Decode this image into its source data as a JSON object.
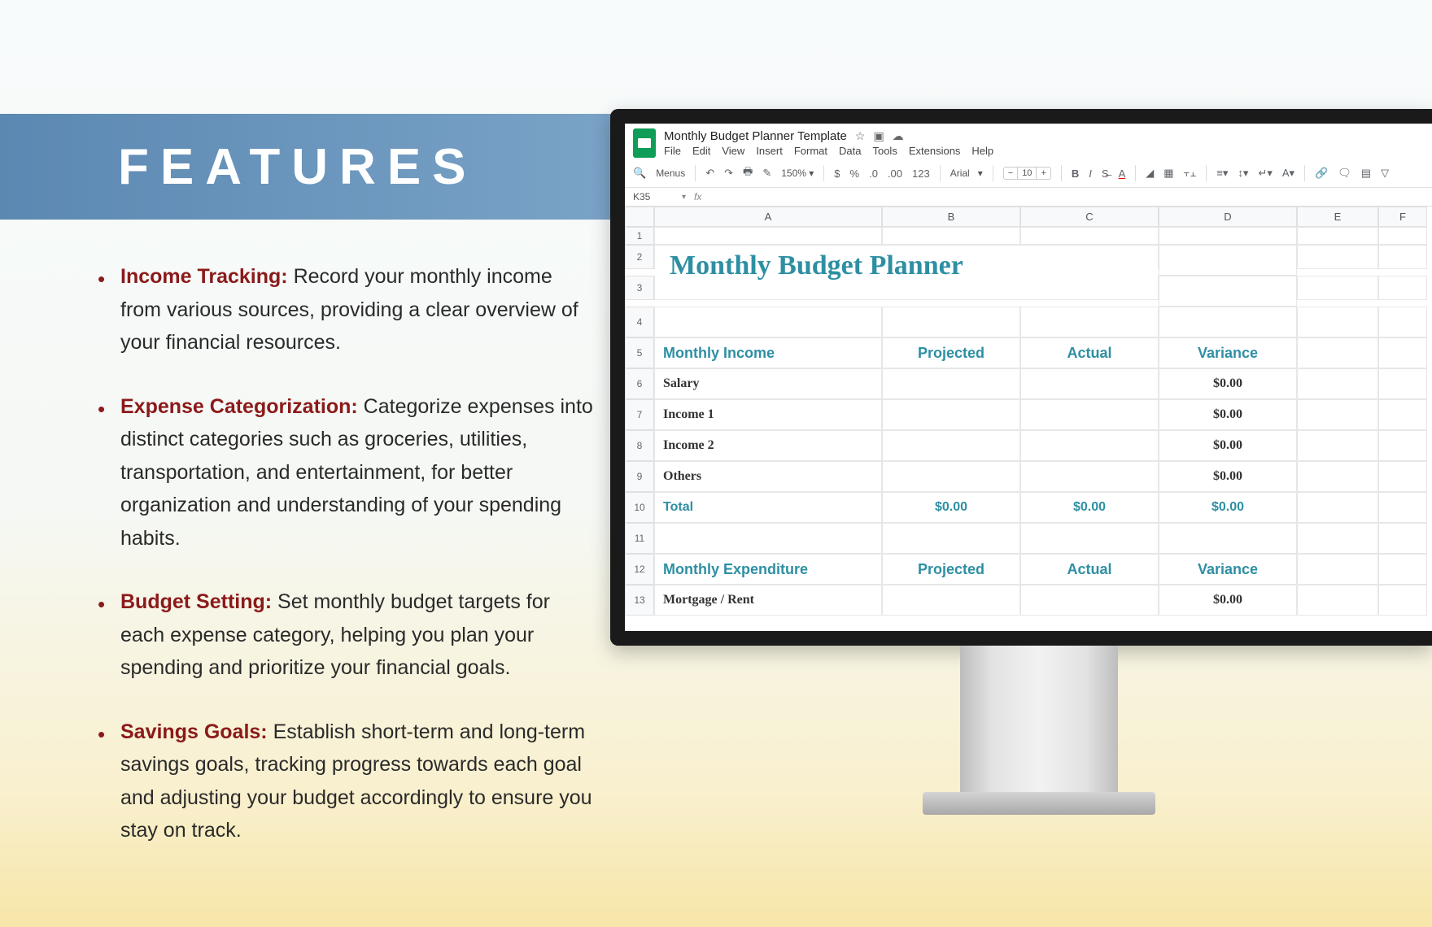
{
  "header": {
    "title": "FEATURES"
  },
  "features": [
    {
      "title": "Income Tracking:",
      "body": " Record your monthly income from various sources, providing a clear overview of your financial resources."
    },
    {
      "title": "Expense Categorization:",
      "body": " Categorize expenses into distinct categories such as groceries, utilities, transportation, and entertainment, for better organization and understanding of your spending habits."
    },
    {
      "title": "Budget Setting:",
      "body": " Set monthly budget targets for each expense category, helping you plan your spending and prioritize your financial goals."
    },
    {
      "title": "Savings Goals:",
      "body": " Establish short-term and long-term savings goals, tracking progress towards each goal and adjusting your budget accordingly to ensure you stay on track."
    }
  ],
  "sheets": {
    "doc_title": "Monthly Budget Planner Template",
    "menus": [
      "File",
      "Edit",
      "View",
      "Insert",
      "Format",
      "Data",
      "Tools",
      "Extensions",
      "Help"
    ],
    "search_label": "Menus",
    "zoom": "150%",
    "font": "Arial",
    "font_size": "10",
    "cell_ref": "K35",
    "columns": [
      "A",
      "B",
      "C",
      "D",
      "E",
      "F"
    ],
    "big_title": "Monthly Budget Planner",
    "income_header": {
      "a": "Monthly Income",
      "b": "Projected",
      "c": "Actual",
      "d": "Variance"
    },
    "income_rows": [
      {
        "n": "6",
        "a": "Salary",
        "d": "$0.00"
      },
      {
        "n": "7",
        "a": "Income 1",
        "d": "$0.00"
      },
      {
        "n": "8",
        "a": "Income 2",
        "d": "$0.00"
      },
      {
        "n": "9",
        "a": "Others",
        "d": "$0.00"
      }
    ],
    "total_row": {
      "n": "10",
      "a": "Total",
      "b": "$0.00",
      "c": "$0.00",
      "d": "$0.00"
    },
    "expend_header": {
      "n": "12",
      "a": "Monthly Expenditure",
      "b": "Projected",
      "c": "Actual",
      "d": "Variance"
    },
    "expend_rows": [
      {
        "n": "13",
        "a": "Mortgage / Rent",
        "d": "$0.00"
      }
    ]
  }
}
